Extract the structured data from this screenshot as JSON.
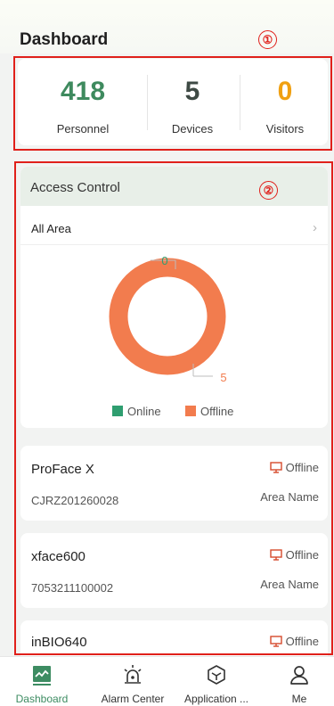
{
  "header": {
    "title": "Dashboard"
  },
  "annotations": {
    "marker_1": "①",
    "marker_2": "②"
  },
  "stats": [
    {
      "value": "418",
      "label": "Personnel",
      "color": "#3e8a5e"
    },
    {
      "value": "5",
      "label": "Devices",
      "color": "#3e4a44"
    },
    {
      "value": "0",
      "label": "Visitors",
      "color": "#f0a012"
    }
  ],
  "access_control": {
    "title": "Access Control",
    "area": "All Area",
    "chart_data": {
      "type": "pie",
      "categories": [
        "Online",
        "Offline"
      ],
      "values": [
        0,
        5
      ],
      "colors": [
        "#2f9e70",
        "#f27c4e"
      ]
    },
    "legend": [
      "Online",
      "Offline"
    ],
    "online_label": "0",
    "offline_label": "5"
  },
  "devices": [
    {
      "name": "ProFace X",
      "serial": "CJRZ201260028",
      "status": "Offline",
      "area": "Area Name"
    },
    {
      "name": "xface600",
      "serial": "7053211100002",
      "status": "Offline",
      "area": "Area Name"
    },
    {
      "name": "inBIO640",
      "status": "Offline"
    }
  ],
  "tabs": [
    {
      "label": "Dashboard",
      "icon": "chart-monitor-icon",
      "active": true
    },
    {
      "label": "Alarm Center",
      "icon": "alarm-siren-icon"
    },
    {
      "label": "Application ...",
      "icon": "cube-icon"
    },
    {
      "label": "Me",
      "icon": "person-icon"
    }
  ],
  "colors": {
    "accent": "#3d8c62",
    "offline": "#f27c4e",
    "online": "#2f9e70",
    "status_icon": "#d64a2c",
    "annotation": "#e0201b"
  }
}
